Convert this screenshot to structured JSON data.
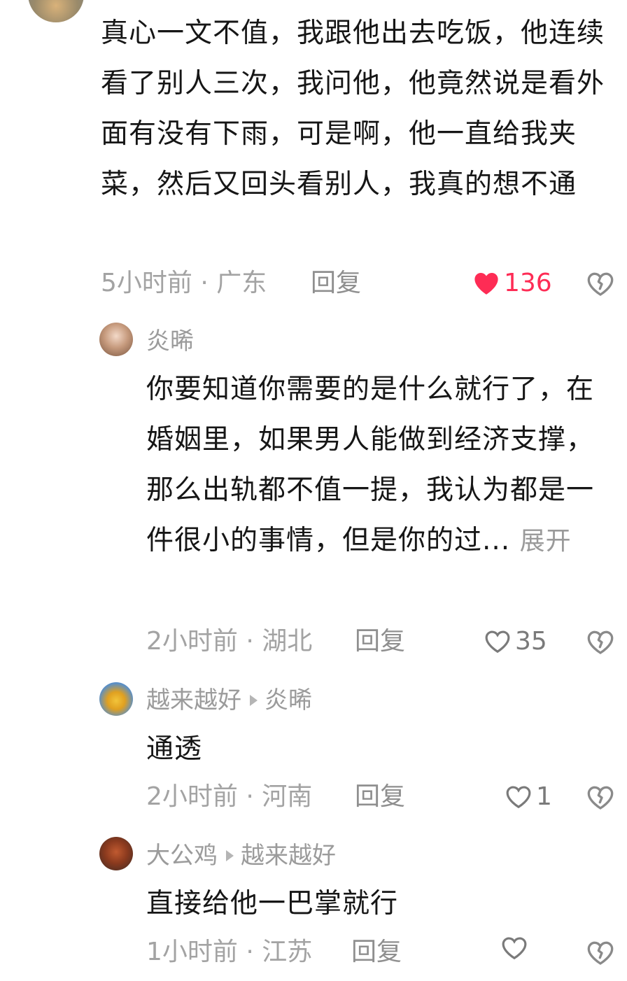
{
  "main_comment": {
    "text": "真心一文不值，我跟他出去吃饭，他连续看了别人三次，我问他，他竟然说是看外面有没有下雨，可是啊，他一直给我夹菜，然后又回头看别人，我真的想不通",
    "time_location": "5小时前 · 广东",
    "reply_label": "回复",
    "likes": "136",
    "liked": true
  },
  "replies": [
    {
      "username": "炎晞",
      "reply_to": "",
      "text": "你要知道你需要的是什么就行了，在婚姻里，如果男人能做到经济支撑，那么出轨都不值一提，我认为都是一件很小的事情，但是你的过...",
      "expand_label": "展开",
      "time_location": "2小时前 · 湖北",
      "reply_label": "回复",
      "likes": "35"
    },
    {
      "username": "越来越好",
      "reply_to": "炎晞",
      "text": "通透",
      "time_location": "2小时前 · 河南",
      "reply_label": "回复",
      "likes": "1"
    },
    {
      "username": "大公鸡",
      "reply_to": "越来越好",
      "text": "直接给他一巴掌就行",
      "time_location": "1小时前 · 江苏",
      "reply_label": "回复",
      "likes": ""
    }
  ],
  "colors": {
    "like_red": "#fe2c55",
    "meta_gray": "#a3a3a3",
    "text": "#161616"
  },
  "icons": [
    "heart-filled-icon",
    "heart-outline-icon",
    "dislike-broken-heart-icon",
    "reply-arrow-icon"
  ]
}
